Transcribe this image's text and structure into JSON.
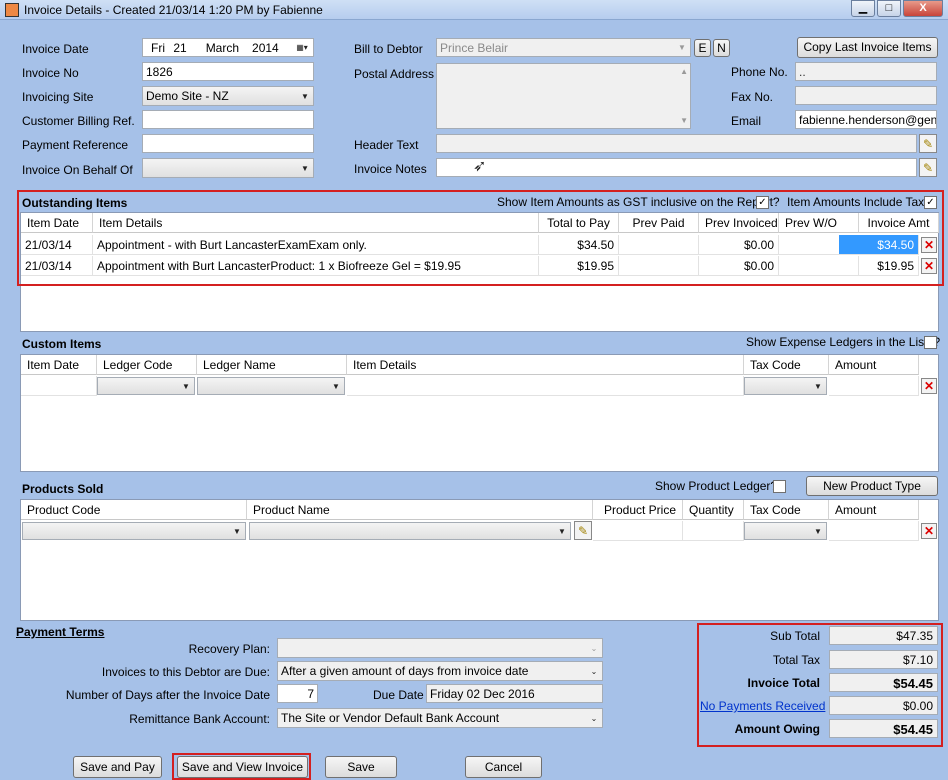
{
  "window": {
    "title": "Invoice Details - Created 21/03/14 1:20 PM by Fabienne",
    "min": "▁",
    "max": "□",
    "close": "X"
  },
  "header": {
    "invoice_date_label": "Invoice Date",
    "invoice_date": {
      "day": "Fri",
      "date": "21",
      "month": "March",
      "year": "2014"
    },
    "invoice_no_label": "Invoice No",
    "invoice_no": "1826",
    "invoicing_site_label": "Invoicing Site",
    "invoicing_site": "Demo Site - NZ",
    "customer_billing_ref_label": "Customer Billing Ref.",
    "customer_billing_ref": "",
    "payment_reference_label": "Payment Reference",
    "payment_reference": "",
    "invoice_on_behalf_label": "Invoice On Behalf Of",
    "invoice_on_behalf": "",
    "bill_to_debtor_label": "Bill to Debtor",
    "bill_to_debtor": "Prince Belair",
    "e_button": "E",
    "n_button": "N",
    "postal_address_label": "Postal Address",
    "postal_address": "",
    "header_text_label": "Header Text",
    "header_text": "",
    "invoice_notes_label": "Invoice Notes",
    "invoice_notes": "",
    "copy_last_button": "Copy Last Invoice Items",
    "phone_label": "Phone No.",
    "phone": "..",
    "fax_label": "Fax No.",
    "fax": "",
    "email_label": "Email",
    "email": "fabienne.henderson@gensol"
  },
  "outstanding": {
    "title": "Outstanding Items",
    "gst_label": "Show Item Amounts as GST inclusive on the Report?",
    "gst_checked": "✓",
    "incl_tax_label": "Item Amounts Include Tax?",
    "incl_tax_checked": "✓",
    "columns": [
      "Item Date",
      "Item Details",
      "Total to Pay",
      "Prev Paid",
      "Prev Invoiced",
      "Prev W/O",
      "Invoice Amt"
    ],
    "rows": [
      {
        "date": "21/03/14",
        "details": "Appointment - with Burt LancasterExamExam only.",
        "total": "$34.50",
        "prev_paid": "",
        "prev_invoiced": "$0.00",
        "prev_wo": "",
        "amount": "$34.50"
      },
      {
        "date": "21/03/14",
        "details": "Appointment with Burt LancasterProduct: 1 x Biofreeze Gel = $19.95",
        "total": "$19.95",
        "prev_paid": "",
        "prev_invoiced": "$0.00",
        "prev_wo": "",
        "amount": "$19.95"
      }
    ]
  },
  "custom": {
    "title": "Custom Items",
    "expense_label": "Show Expense Ledgers in the Lists?",
    "columns": [
      "Item Date",
      "Ledger Code",
      "Ledger Name",
      "Item Details",
      "Tax Code",
      "Amount"
    ]
  },
  "products": {
    "title": "Products Sold",
    "ledger_label": "Show Product Ledger?",
    "new_type_button": "New Product Type",
    "columns": [
      "Product Code",
      "Product Name",
      "Product Price",
      "Quantity",
      "Tax Code",
      "Amount"
    ]
  },
  "payment_terms": {
    "title": "Payment Terms",
    "recovery_label": "Recovery Plan:",
    "recovery": "",
    "due_label": "Invoices to this Debtor are Due:",
    "due": "After a given amount of days from invoice date",
    "days_label": "Number of Days after the Invoice Date",
    "days": "7",
    "due_date_label": "Due Date",
    "due_date": "Friday 02 Dec 2016",
    "bank_label": "Remittance Bank Account:",
    "bank": "The Site or Vendor Default Bank Account"
  },
  "totals": {
    "sub_total_label": "Sub Total",
    "sub_total": "$47.35",
    "total_tax_label": "Total Tax",
    "total_tax": "$7.10",
    "invoice_total_label": "Invoice Total",
    "invoice_total": "$54.45",
    "payments_label": "No Payments Received",
    "payments": "$0.00",
    "owing_label": "Amount Owing",
    "owing": "$54.45"
  },
  "footer": {
    "save_pay": "Save and Pay",
    "save_view": "Save and View Invoice",
    "save": "Save",
    "cancel": "Cancel"
  },
  "colors": {
    "highlight_border": "#d42020",
    "selected_cell": "#3399ff",
    "form_bg": "#a6c1e8"
  }
}
